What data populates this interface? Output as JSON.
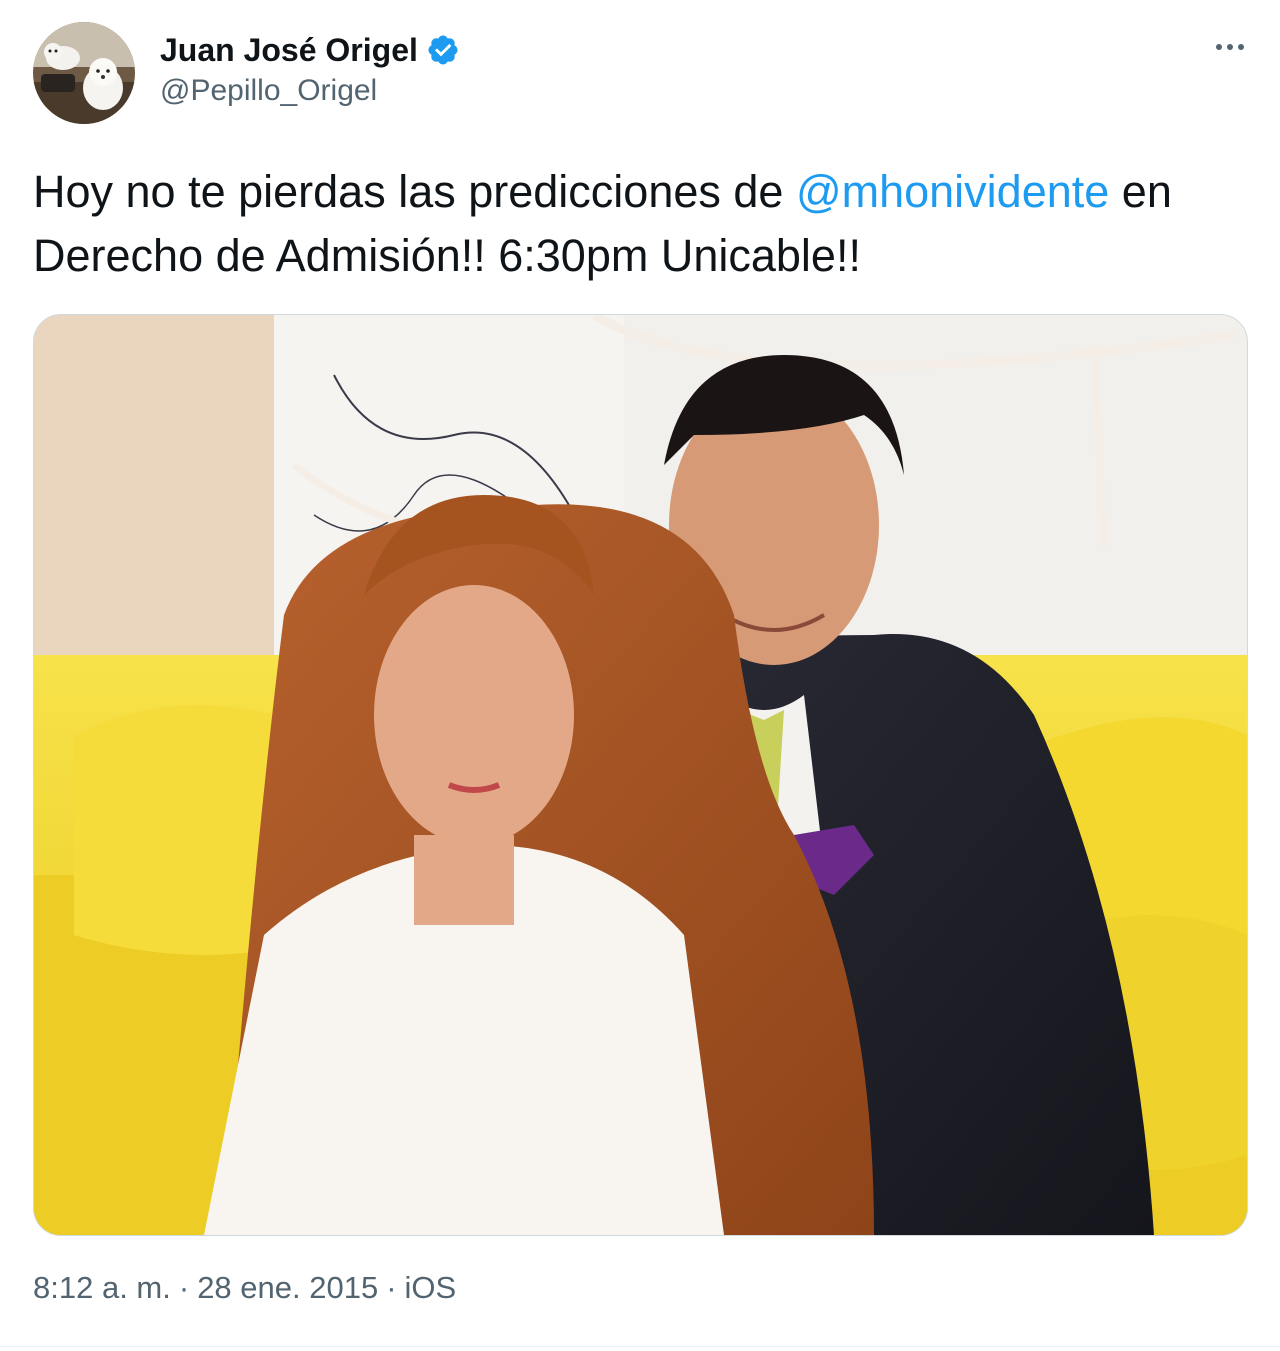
{
  "author": {
    "display_name": "Juan José Origel",
    "handle": "@Pepillo_Origel",
    "verified": true,
    "avatar_icon": "avatar-dogs-photo"
  },
  "tweet": {
    "text_before": "Hoy no te pierdas las predicciones de ",
    "mention": "@mhonividente",
    "text_after": " en Derecho de Admisión!! 6:30pm Unicable!!"
  },
  "media": {
    "kind": "photo"
  },
  "meta": {
    "time": "8:12 a. m.",
    "date": "28 ene. 2015",
    "source": "iOS",
    "separator": "·"
  },
  "colors": {
    "link": "#1d9bf0",
    "secondary_text": "#536471",
    "border": "#cfd9de",
    "verified_badge": "#1d9bf0"
  },
  "icons": {
    "verified": "verified-badge-icon",
    "more": "more-options-icon"
  }
}
